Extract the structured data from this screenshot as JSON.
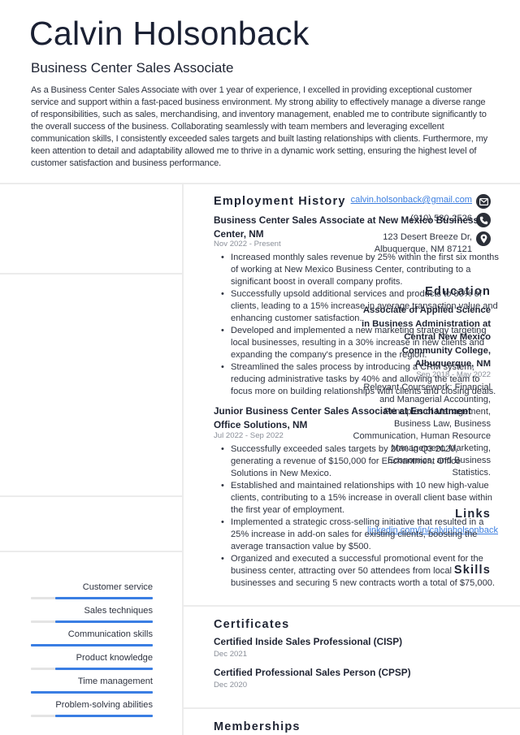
{
  "header": {
    "name": "Calvin Holsonback",
    "job_title": "Business Center Sales Associate",
    "summary": "As a Business Center Sales Associate with over 1 year of experience, I excelled in providing exceptional customer service and support within a fast-paced business environment. My strong ability to effectively manage a diverse range of responsibilities, such as sales, merchandising, and inventory management, enabled me to contribute significantly to the overall success of the business. Collaborating seamlessly with team members and leveraging excellent communication skills, I consistently exceeded sales targets and built lasting relationships with clients. Furthermore, my keen attention to detail and adaptability allowed me to thrive in a dynamic work setting, ensuring the highest level of customer satisfaction and business performance."
  },
  "contact": {
    "email": "calvin.holsonback@gmail.com",
    "email_icon": "envelope-icon",
    "phone": "(910) 530-2526",
    "phone_icon": "phone-icon",
    "address_line1": "123 Desert Breeze Dr,",
    "address_line2": "Albuquerque, NM 87121",
    "address_icon": "map-pin-icon"
  },
  "education": {
    "heading": "Education",
    "degree": "Associate of Applied Science in Business Administration at Central New Mexico Community College, Albuquerque, NM",
    "dates": "Sep 2018 - May 2022",
    "coursework": "Relevant Coursework: Financial and Managerial Accounting, Principles of Management, Business Law, Business Communication, Human Resource Management, Marketing, Economics, and Business Statistics."
  },
  "links": {
    "heading": "Links",
    "items": [
      {
        "label": "linkedin.com/in/calvinholsonback"
      }
    ]
  },
  "skills": {
    "heading": "Skills",
    "items": [
      {
        "label": "Customer service",
        "level": 0.8
      },
      {
        "label": "Sales techniques",
        "level": 0.8
      },
      {
        "label": "Communication skills",
        "level": 1.0
      },
      {
        "label": "Product knowledge",
        "level": 0.8
      },
      {
        "label": "Time management",
        "level": 1.0
      },
      {
        "label": "Problem-solving abilities",
        "level": 0.8
      }
    ]
  },
  "employment": {
    "heading": "Employment History",
    "jobs": [
      {
        "title": "Business Center Sales Associate at New Mexico Business Center, NM",
        "dates": "Nov 2022 - Present",
        "bullets": [
          "Increased monthly sales revenue by 25% within the first six months of working at New Mexico Business Center, contributing to a significant boost in overall company profits.",
          "Successfully upsold additional services and products to 80% of clients, leading to a 15% increase in average transaction value and enhancing customer satisfaction.",
          "Developed and implemented a new marketing strategy targeting local businesses, resulting in a 30% increase in new clients and expanding the company's presence in the region.",
          "Streamlined the sales process by introducing a CRM system, reducing administrative tasks by 40% and allowing the team to focus more on building relationships with clients and closing deals."
        ]
      },
      {
        "title": "Junior Business Center Sales Associate at Enchantment Office Solutions, NM",
        "dates": "Jul 2022 - Sep 2022",
        "bullets": [
          "Successfully exceeded sales targets by 20% in Q3 2020, generating a revenue of $150,000 for Enchantment Office Solutions in New Mexico.",
          "Established and maintained relationships with 10 new high-value clients, contributing to a 15% increase in overall client base within the first year of employment.",
          "Implemented a strategic cross-selling initiative that resulted in a 25% increase in add-on sales for existing clients, boosting the average transaction value by $500.",
          "Organized and executed a successful promotional event for the business center, attracting over 50 attendees from local businesses and securing 5 new contracts worth a total of $75,000."
        ]
      }
    ]
  },
  "certificates": {
    "heading": "Certificates",
    "items": [
      {
        "name": "Certified Inside Sales Professional (CISP)",
        "date": "Dec 2021"
      },
      {
        "name": "Certified Professional Sales Person (CPSP)",
        "date": "Dec 2020"
      }
    ]
  },
  "memberships": {
    "heading": "Memberships"
  },
  "colors": {
    "accent": "#3a7ee3",
    "link": "#3b7ee0",
    "heading": "#1f2433",
    "muted": "#8a8f99",
    "icon_bg": "#2b2f38"
  }
}
